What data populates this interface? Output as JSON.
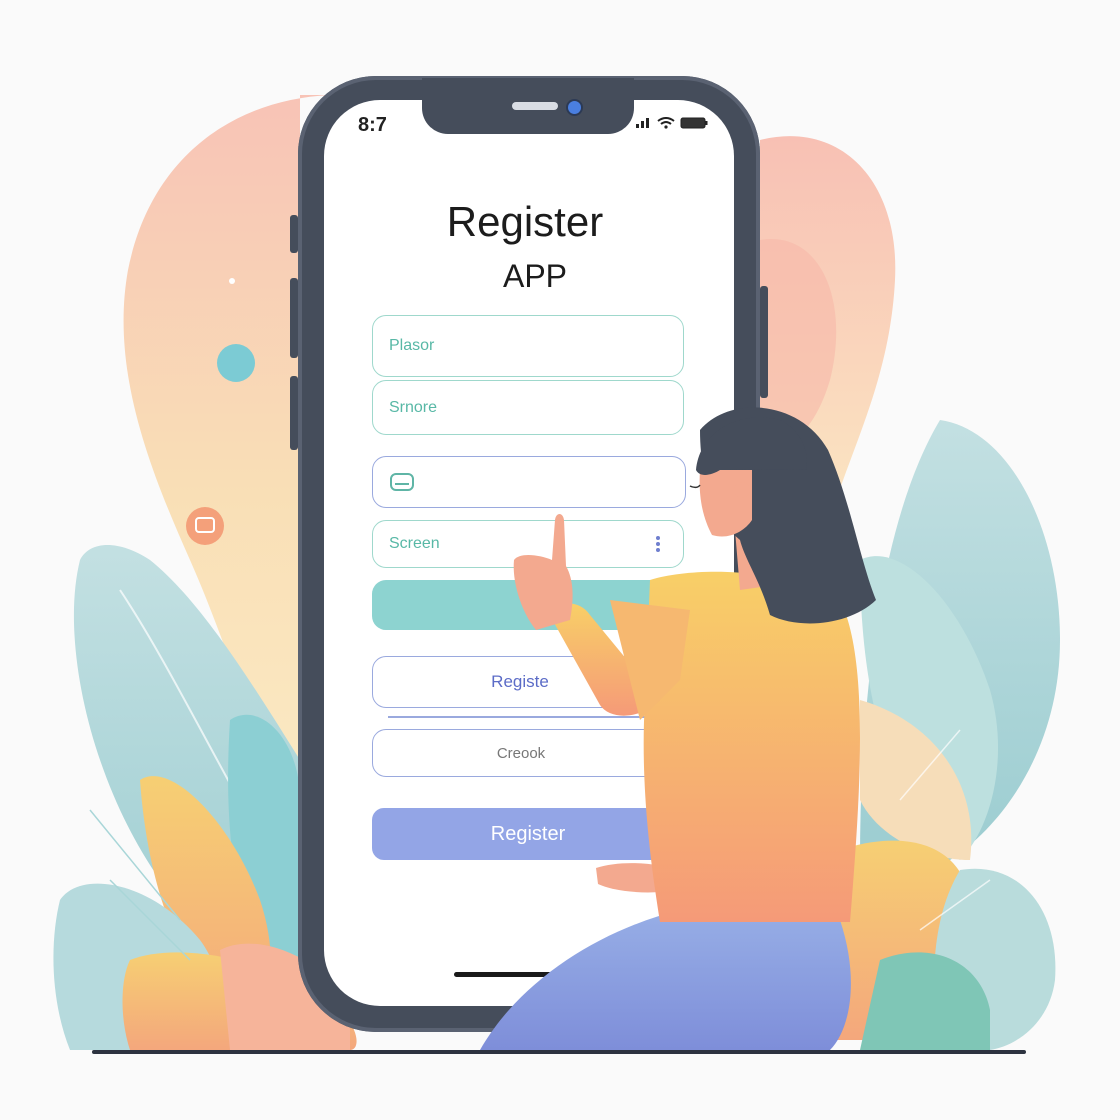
{
  "status_bar": {
    "time": "8:7"
  },
  "screen": {
    "title": "Register",
    "subtitle": "APP"
  },
  "form": {
    "field1_placeholder": "Plasor",
    "field2_placeholder": "Srnore",
    "field4_placeholder": "Screen",
    "register_option_label": "Registe",
    "second_option_label": "Creook",
    "submit_label": "Register"
  },
  "colors": {
    "frame": "#454d5b",
    "accent_teal": "#8dd3d0",
    "accent_purple": "#93a5e6",
    "field_border_green": "#9fd8cc",
    "field_border_blue": "#9aa9de"
  }
}
